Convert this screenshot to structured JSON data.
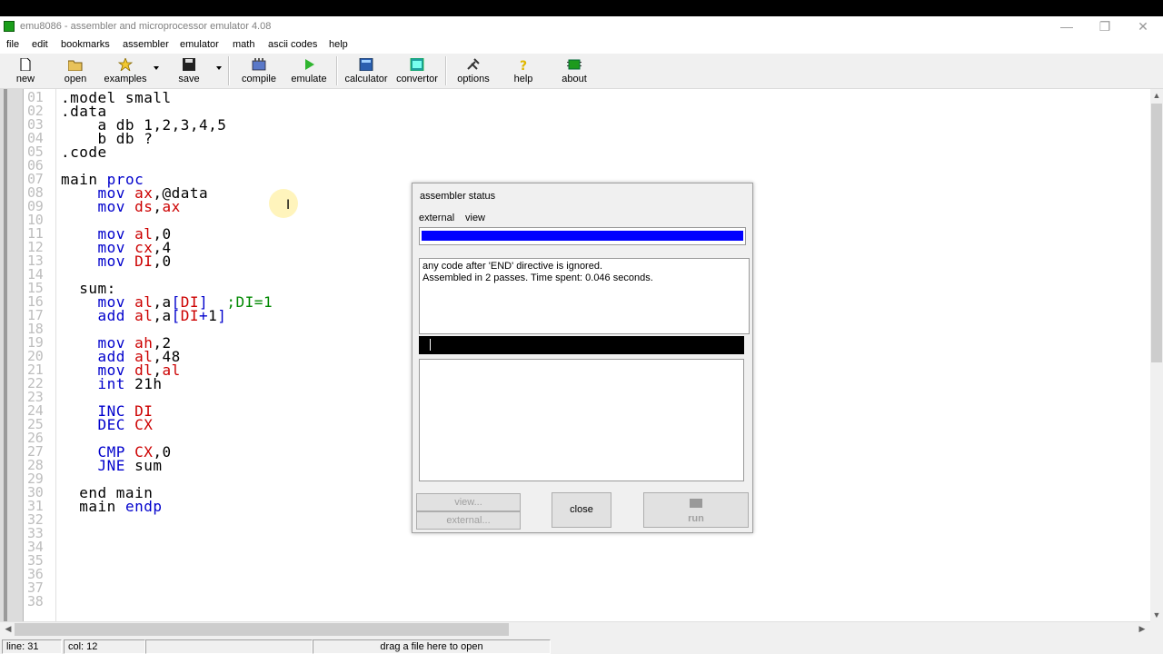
{
  "window": {
    "title": "emu8086 - assembler and microprocessor emulator 4.08",
    "controls": [
      "—",
      "❐",
      "✕"
    ]
  },
  "menu": [
    "file",
    "edit",
    "bookmarks",
    "assembler",
    "emulator",
    "math",
    "ascii codes",
    "help"
  ],
  "toolbar": {
    "new": "new",
    "open": "open",
    "examples": "examples",
    "save": "save",
    "compile": "compile",
    "emulate": "emulate",
    "calculator": "calculator",
    "convertor": "convertor",
    "options": "options",
    "help": "help",
    "about": "about"
  },
  "editor": {
    "line_numbers": [
      "01",
      "02",
      "03",
      "04",
      "05",
      "06",
      "07",
      "08",
      "09",
      "10",
      "11",
      "12",
      "13",
      "14",
      "15",
      "16",
      "17",
      "18",
      "19",
      "20",
      "21",
      "22",
      "23",
      "24",
      "25",
      "26",
      "27",
      "28",
      "29",
      "30",
      "31",
      "32",
      "33",
      "34",
      "35",
      "36",
      "37",
      "38"
    ],
    "lines": [
      [
        {
          "t": ".model small",
          "c": "lbl"
        }
      ],
      [
        {
          "t": ".data",
          "c": "lbl"
        }
      ],
      [
        {
          "t": "    a db 1,2,3,4,5",
          "c": "lbl"
        }
      ],
      [
        {
          "t": "    b db ?",
          "c": "lbl"
        }
      ],
      [
        {
          "t": ".code",
          "c": "lbl"
        }
      ],
      [],
      [
        {
          "t": "main ",
          "c": "lbl"
        },
        {
          "t": "proc",
          "c": "kw"
        }
      ],
      [
        {
          "t": "    ",
          "c": "lbl"
        },
        {
          "t": "mov ",
          "c": "kw"
        },
        {
          "t": "ax",
          "c": "reg"
        },
        {
          "t": ",@data",
          "c": "lbl"
        }
      ],
      [
        {
          "t": "    ",
          "c": "lbl"
        },
        {
          "t": "mov ",
          "c": "kw"
        },
        {
          "t": "ds",
          "c": "reg"
        },
        {
          "t": ",",
          "c": "lbl"
        },
        {
          "t": "ax",
          "c": "reg"
        }
      ],
      [],
      [
        {
          "t": "    ",
          "c": "lbl"
        },
        {
          "t": "mov ",
          "c": "kw"
        },
        {
          "t": "al",
          "c": "reg"
        },
        {
          "t": ",0",
          "c": "lbl"
        }
      ],
      [
        {
          "t": "    ",
          "c": "lbl"
        },
        {
          "t": "mov ",
          "c": "kw"
        },
        {
          "t": "cx",
          "c": "reg"
        },
        {
          "t": ",4",
          "c": "lbl"
        }
      ],
      [
        {
          "t": "    ",
          "c": "lbl"
        },
        {
          "t": "mov ",
          "c": "kw"
        },
        {
          "t": "DI",
          "c": "reg"
        },
        {
          "t": ",0",
          "c": "lbl"
        }
      ],
      [],
      [
        {
          "t": "  sum:",
          "c": "lbl"
        }
      ],
      [
        {
          "t": "    ",
          "c": "lbl"
        },
        {
          "t": "mov ",
          "c": "kw"
        },
        {
          "t": "al",
          "c": "reg"
        },
        {
          "t": ",a",
          "c": "lbl"
        },
        {
          "t": "[",
          "c": "kw"
        },
        {
          "t": "DI",
          "c": "reg"
        },
        {
          "t": "]  ",
          "c": "kw"
        },
        {
          "t": ";DI=1",
          "c": "cmt"
        }
      ],
      [
        {
          "t": "    ",
          "c": "lbl"
        },
        {
          "t": "add ",
          "c": "kw"
        },
        {
          "t": "al",
          "c": "reg"
        },
        {
          "t": ",a",
          "c": "lbl"
        },
        {
          "t": "[",
          "c": "kw"
        },
        {
          "t": "DI",
          "c": "reg"
        },
        {
          "t": "+",
          "c": "kw"
        },
        {
          "t": "1",
          "c": "lbl"
        },
        {
          "t": "]",
          "c": "kw"
        }
      ],
      [],
      [
        {
          "t": "    ",
          "c": "lbl"
        },
        {
          "t": "mov ",
          "c": "kw"
        },
        {
          "t": "ah",
          "c": "reg"
        },
        {
          "t": ",2",
          "c": "lbl"
        }
      ],
      [
        {
          "t": "    ",
          "c": "lbl"
        },
        {
          "t": "add ",
          "c": "kw"
        },
        {
          "t": "al",
          "c": "reg"
        },
        {
          "t": ",48",
          "c": "lbl"
        }
      ],
      [
        {
          "t": "    ",
          "c": "lbl"
        },
        {
          "t": "mov ",
          "c": "kw"
        },
        {
          "t": "dl",
          "c": "reg"
        },
        {
          "t": ",",
          "c": "lbl"
        },
        {
          "t": "al",
          "c": "reg"
        }
      ],
      [
        {
          "t": "    ",
          "c": "lbl"
        },
        {
          "t": "int ",
          "c": "kw"
        },
        {
          "t": "21h",
          "c": "lbl"
        }
      ],
      [],
      [
        {
          "t": "    ",
          "c": "lbl"
        },
        {
          "t": "INC ",
          "c": "kw"
        },
        {
          "t": "DI",
          "c": "reg"
        }
      ],
      [
        {
          "t": "    ",
          "c": "lbl"
        },
        {
          "t": "DEC ",
          "c": "kw"
        },
        {
          "t": "CX",
          "c": "reg"
        }
      ],
      [],
      [
        {
          "t": "    ",
          "c": "lbl"
        },
        {
          "t": "CMP ",
          "c": "kw"
        },
        {
          "t": "CX",
          "c": "reg"
        },
        {
          "t": ",0",
          "c": "lbl"
        }
      ],
      [
        {
          "t": "    ",
          "c": "lbl"
        },
        {
          "t": "JNE ",
          "c": "kw"
        },
        {
          "t": "sum",
          "c": "lbl"
        }
      ],
      [],
      [
        {
          "t": "  end main",
          "c": "lbl"
        }
      ],
      [
        {
          "t": "  main ",
          "c": "lbl"
        },
        {
          "t": "endp",
          "c": "kw"
        }
      ]
    ]
  },
  "status": {
    "line": "line: 31",
    "col": "col: 12",
    "blank": "",
    "hint": "drag a file here to open"
  },
  "dialog": {
    "title": "assembler status",
    "menu_external": "external",
    "menu_view": "view",
    "progress": 1.0,
    "progress_color": "#0000ff",
    "messages": [
      "any code after 'END' directive is ignored.",
      "Assembled in 2 passes. Time spent: 0.046 seconds."
    ],
    "btn_view": "view...",
    "btn_external": "external...",
    "btn_close": "close",
    "btn_run": "run"
  },
  "colors": {
    "keyword": "#0000cc",
    "register": "#cc0000",
    "comment": "#008800"
  }
}
